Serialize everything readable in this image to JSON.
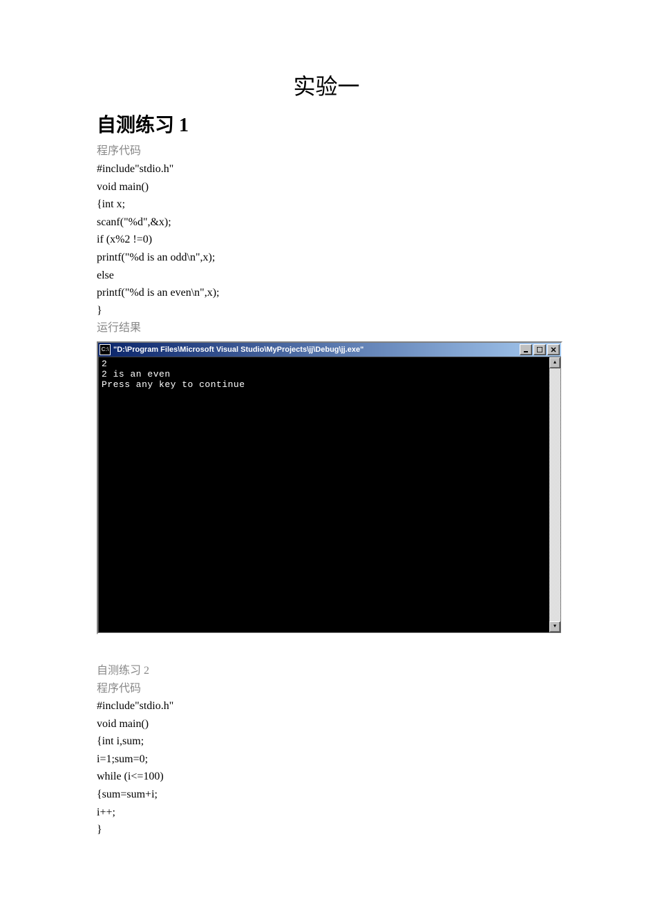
{
  "title": "实验一",
  "section1": {
    "header": "自测练习 1",
    "code_label": "程序代码",
    "code": [
      "#include\"stdio.h\"",
      "void main()",
      "{int x;",
      "scanf(\"%d\",&x);",
      "if (x%2 !=0)",
      "printf(\"%d is an odd\\n\",x);",
      "else",
      "printf(\"%d is an even\\n\",x);",
      "}"
    ],
    "result_label": "运行结果"
  },
  "console": {
    "icon_text": "C:\\",
    "title": "\"D:\\Program Files\\Microsoft Visual Studio\\MyProjects\\jj\\Debug\\jj.exe\"",
    "output": "2\n2 is an even\nPress any key to continue"
  },
  "section2": {
    "header": "自测练习 2",
    "code_label": "程序代码",
    "code": [
      "#include\"stdio.h\"",
      "void main()",
      "{int i,sum;",
      "i=1;sum=0;",
      "while (i<=100)",
      "{sum=sum+i;",
      "i++;",
      "}"
    ]
  }
}
